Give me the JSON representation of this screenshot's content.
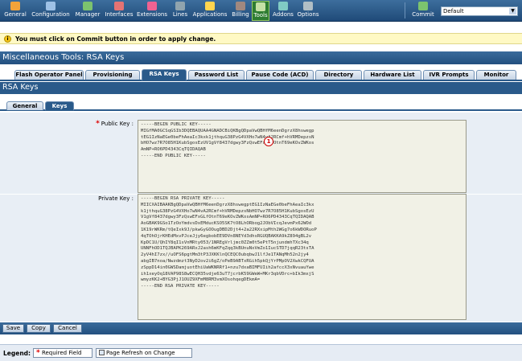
{
  "toolbar": {
    "items": [
      {
        "label": "General",
        "icon": "general-icon",
        "color": "#f2a33a"
      },
      {
        "label": "Configuration",
        "icon": "configuration-icon",
        "color": "#9ec1e6"
      },
      {
        "label": "Manager",
        "icon": "manager-icon",
        "color": "#7cc36e"
      },
      {
        "label": "Interfaces",
        "icon": "interfaces-icon",
        "color": "#e57373"
      },
      {
        "label": "Extensions",
        "icon": "extensions-icon",
        "color": "#f06292"
      },
      {
        "label": "Lines",
        "icon": "lines-icon",
        "color": "#90a4ae"
      },
      {
        "label": "Applications",
        "icon": "applications-icon",
        "color": "#ffd54f"
      },
      {
        "label": "Billing",
        "icon": "billing-icon",
        "color": "#a1887f"
      },
      {
        "label": "Tools",
        "icon": "tools-icon",
        "color": "#c5e1a5"
      },
      {
        "label": "Addons",
        "icon": "addons-icon",
        "color": "#80cbc4"
      },
      {
        "label": "Options",
        "icon": "options-icon",
        "color": "#b0bec5"
      }
    ],
    "commit_label": "Commit",
    "commit_icon_color": "#7cc36e",
    "commit_select_value": "Default"
  },
  "notice": {
    "text": "You must click on Commit button in order to apply change."
  },
  "page_title": "Miscellaneous Tools: RSA Keys",
  "tabs": [
    {
      "label": "Flash Operator Panel",
      "active": false
    },
    {
      "label": "Provisioning",
      "active": false
    },
    {
      "label": "RSA Keys",
      "active": true
    },
    {
      "label": "Password List",
      "active": false
    },
    {
      "label": "Pause Code (ACD)",
      "active": false
    },
    {
      "label": "Directory",
      "active": false
    },
    {
      "label": "Hardware List",
      "active": false
    },
    {
      "label": "IVR Prompts",
      "active": false
    },
    {
      "label": "Monitor",
      "active": false
    }
  ],
  "section_title": "RSA Keys",
  "subtabs": [
    {
      "label": "General",
      "active": false
    },
    {
      "label": "Keys",
      "active": true
    }
  ],
  "form": {
    "public_key_label": "Public Key :",
    "public_key_value": "-----BEGIN PUBLIC KEY-----\nMIGfMA0GCSqGSIb3DQEBAQUAA4GNADCBiQKBgQDpaVwQBHfM6eenDgrzX8hswegp\ntEG1IzNaEGe0beFhAeaIc3kxk1jthquG38PzG4VXHo7wN4vA2RCmf+hVRMDepzsN\nbHO7wz7R7O85H1KubSgosEzUV1gVf8437dgwy3FzQswEFxGLfOtnT69eKOvZWKos\nAmNP+RO6PD4343CqTQIDAQAB\n-----END PUBLIC KEY-----",
    "callout_number": "1",
    "private_key_label": "Private Key :",
    "private_key_value": "-----BEGIN RSA PRIVATE KEY-----\nMIICXAIBAAKBgQDpaVwQBHfM6eenDgrzX8hswegptEG1IzNaEGe0beFhAeaIc3kx\nk1jthquG38PzG4VXHo7wN4vA2RCmf+hVRMDepzsNbHO7wz7R7O85H1KubSgosEzU\nV1gVf8437dgwy3FzQswEFxGLfOtnT69eKOvZWKosAmNP+RO6PD4343CqTQIDAQAB\nAoGBAK9GSo1TzOoYmdvsDxEMducKSO5SK7tO8LhORbog2JObVIcqJevmPx62WOd\n1K19rWKRm/tQeIxk9J/pkwGyGOOugDBD2Djt4+2a22RXxipMth2WGg7o6kWDORuoP\n4qTOhOjrKHEdMxvPJceJjy6egbobEE9DVn8NEYd3dhsRGUQBAKKA9kZ894gBL2v\nKpDC1U/QhIY8qI1sVnMRty053/1NREgVrljmc0ZZm0t5ePtT5njundmhTXc34q\nUNNFhOD1TQJBAPK269ARxJ2ash6mKFqZqq3kBUnuNxVmZo1IucSTD7jqqR23tsTA\n2yV4hI7zx//uOFS6pgtMm3tP3JXKKlnQCEQC0ubqbwJ1lfJe1TANqMh52n2jy4\nabgIB7noa/Nwzdmzt3NyD2ov2i6gZ/oPeB9ABTxRGih5pkQjYrPMpOV2XwkCQFUA\nzSppD14in0GWSDamjuotEhiUaWKNRRf1+nzu7dxaBIMFUIih2afccX3xNvuauYwe\nih1xeyOq18VAP98S8wECQH35vdje63uT7jcrbK59GWeW+MKr3qbVDrc+bIk3mxjS\nwmyzKK2+BYG3PjJ1OUZ9XFmM8RM3vmXOsohqegDEkmA=\n-----END RSA PRIVATE KEY-----"
  },
  "actions": {
    "save_label": "Save",
    "copy_label": "Copy",
    "cancel_label": "Cancel"
  },
  "legend": {
    "label": "Legend:",
    "required_field": "Required Field",
    "page_refresh": "Page Refresh on Change"
  }
}
